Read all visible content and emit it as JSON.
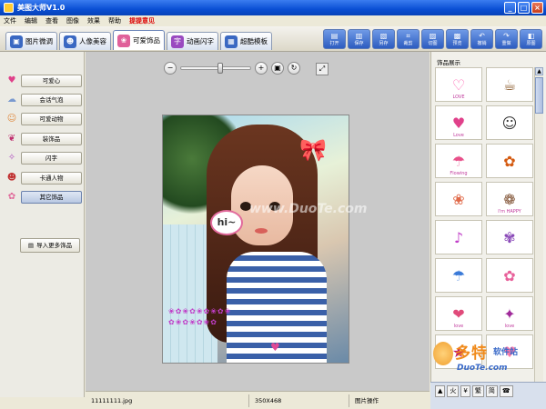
{
  "window": {
    "title": "美图大师V1.0",
    "min": "_",
    "max": "□",
    "close": "×"
  },
  "menu": {
    "items": [
      "文件",
      "编辑",
      "查看",
      "图像",
      "效果",
      "帮助"
    ],
    "highlight": "提提意见"
  },
  "tabs": [
    {
      "label": "图片微调",
      "icon": "▣"
    },
    {
      "label": "人像美容",
      "icon": "☻"
    },
    {
      "label": "可爱饰品",
      "icon": "❀"
    },
    {
      "label": "动画闪字",
      "icon": "字"
    },
    {
      "label": "超酷模板",
      "icon": "▦"
    }
  ],
  "actions": [
    {
      "label": "打开",
      "icon": "▤"
    },
    {
      "label": "保存",
      "icon": "▥"
    },
    {
      "label": "另存",
      "icon": "▧"
    },
    {
      "label": "裁剪",
      "icon": "⌗"
    },
    {
      "label": "切图",
      "icon": "▨"
    },
    {
      "label": "预览",
      "icon": "▩"
    },
    {
      "label": "撤销",
      "icon": "↶"
    },
    {
      "label": "重做",
      "icon": "↷"
    },
    {
      "label": "原图",
      "icon": "◧"
    }
  ],
  "categories": [
    {
      "label": "可爱心",
      "icon": "♥"
    },
    {
      "label": "会话气泡",
      "icon": "☁"
    },
    {
      "label": "可爱动物",
      "icon": "☺"
    },
    {
      "label": "装饰品",
      "icon": "❦"
    },
    {
      "label": "闪字",
      "icon": "✧"
    },
    {
      "label": "卡通人物",
      "icon": "☻"
    },
    {
      "label": "其它饰品",
      "icon": "✿"
    }
  ],
  "import_label": "导入更多饰品",
  "zoom": {
    "minus": "−",
    "plus": "+",
    "actual": "▣",
    "rotate": "↻",
    "fit": "⤢",
    "level": 0.55
  },
  "photo": {
    "bubble": "hi~"
  },
  "right_panel": {
    "title": "饰品展示",
    "items": [
      {
        "glyph": "♡",
        "color": "#ff69b4",
        "sub": "LOVE"
      },
      {
        "glyph": "☕",
        "color": "#8b5a2b",
        "sub": ""
      },
      {
        "glyph": "♥",
        "color": "#e0408a",
        "sub": "Love"
      },
      {
        "glyph": "☺",
        "color": "#333333",
        "sub": ""
      },
      {
        "glyph": "☂",
        "color": "#e8508a",
        "sub": "Flowing"
      },
      {
        "glyph": "✿",
        "color": "#d45a10",
        "sub": ""
      },
      {
        "glyph": "❀",
        "color": "#e06a4a",
        "sub": ""
      },
      {
        "glyph": "❁",
        "color": "#7a4a2a",
        "sub": "I'm HAPPY"
      },
      {
        "glyph": "♪",
        "color": "#c03ec8",
        "sub": ""
      },
      {
        "glyph": "✾",
        "color": "#8a4ab8",
        "sub": ""
      },
      {
        "glyph": "☂",
        "color": "#3a7ad8",
        "sub": ""
      },
      {
        "glyph": "✿",
        "color": "#e8609a",
        "sub": ""
      },
      {
        "glyph": "❤",
        "color": "#e04a7a",
        "sub": "love"
      },
      {
        "glyph": "✦",
        "color": "#a02a9a",
        "sub": "love"
      },
      {
        "glyph": "★",
        "color": "#c01a6a",
        "sub": ""
      },
      {
        "glyph": "♥",
        "color": "#ff7aa8",
        "sub": ""
      }
    ]
  },
  "watermark": "www.DuoTe.com",
  "status": {
    "filename": "11111111.jpg",
    "size": "350X468",
    "mode": "图片操作"
  },
  "logo": {
    "big": "多特",
    "mid": "软件站",
    "url": "DuoTe.com"
  },
  "tray": [
    "▲",
    "火",
    "¥",
    "繁",
    "简",
    "☎"
  ]
}
